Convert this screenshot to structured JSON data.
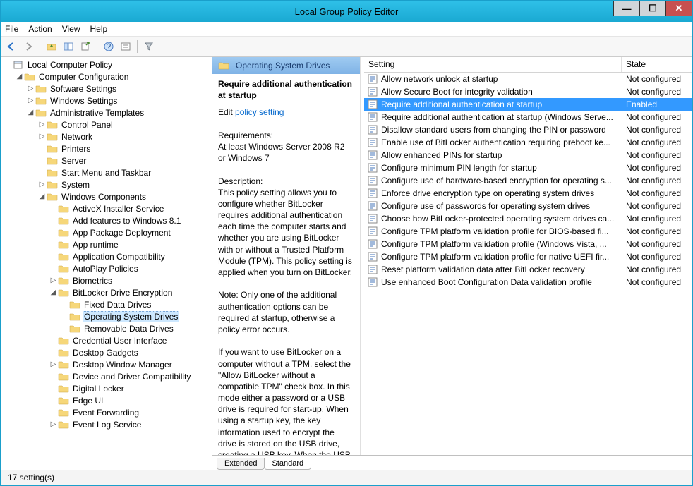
{
  "window": {
    "title": "Local Group Policy Editor"
  },
  "menu": {
    "file": "File",
    "action": "Action",
    "view": "View",
    "help": "Help"
  },
  "tree": {
    "root": "Local Computer Policy",
    "cc": "Computer Configuration",
    "ss": "Software Settings",
    "ws": "Windows Settings",
    "at": "Administrative Templates",
    "cp": "Control Panel",
    "nw": "Network",
    "pr": "Printers",
    "sv": "Server",
    "sm": "Start Menu and Taskbar",
    "sy": "System",
    "wc": "Windows Components",
    "ax": "ActiveX Installer Service",
    "af": "Add features to Windows 8.1",
    "apd": "App Package Deployment",
    "art": "App runtime",
    "ac": "Application Compatibility",
    "ap": "AutoPlay Policies",
    "bm": "Biometrics",
    "bl": "BitLocker Drive Encryption",
    "fdd": "Fixed Data Drives",
    "osd": "Operating System Drives",
    "rdd": "Removable Data Drives",
    "cui": "Credential User Interface",
    "dg": "Desktop Gadgets",
    "dwm": "Desktop Window Manager",
    "ddc": "Device and Driver Compatibility",
    "dl": "Digital Locker",
    "eu": "Edge UI",
    "ef": "Event Forwarding",
    "els": "Event Log Service"
  },
  "detail": {
    "header": "Operating System Drives",
    "policy_name": "Require additional authentication at startup",
    "edit_prefix": "Edit ",
    "edit_link": "policy setting",
    "req_label": "Requirements:",
    "req_text": "At least Windows Server 2008 R2 or Windows 7",
    "desc_label": "Description:",
    "desc_p1": "This policy setting allows you to configure whether BitLocker requires additional authentication each time the computer starts and whether you are using BitLocker with or without a Trusted Platform Module (TPM). This policy setting is applied when you turn on BitLocker.",
    "desc_p2": "Note: Only one of the additional authentication options can be required at startup, otherwise a policy error occurs.",
    "desc_p3": "If you want to use BitLocker on a computer without a TPM, select the \"Allow BitLocker without a compatible TPM\" check box. In this mode either a password or a USB drive is required for start-up. When using a startup key, the key information used to encrypt the drive is stored on the USB drive, creating a USB key. When the USB"
  },
  "list": {
    "col_setting": "Setting",
    "col_state": "State",
    "items": [
      {
        "name": "Allow network unlock at startup",
        "state": "Not configured"
      },
      {
        "name": "Allow Secure Boot for integrity validation",
        "state": "Not configured"
      },
      {
        "name": "Require additional authentication at startup",
        "state": "Enabled",
        "selected": true
      },
      {
        "name": "Require additional authentication at startup (Windows Serve...",
        "state": "Not configured"
      },
      {
        "name": "Disallow standard users from changing the PIN or password",
        "state": "Not configured"
      },
      {
        "name": "Enable use of BitLocker authentication requiring preboot ke...",
        "state": "Not configured"
      },
      {
        "name": "Allow enhanced PINs for startup",
        "state": "Not configured"
      },
      {
        "name": "Configure minimum PIN length for startup",
        "state": "Not configured"
      },
      {
        "name": "Configure use of hardware-based encryption for operating s...",
        "state": "Not configured"
      },
      {
        "name": "Enforce drive encryption type on operating system drives",
        "state": "Not configured"
      },
      {
        "name": "Configure use of passwords for operating system drives",
        "state": "Not configured"
      },
      {
        "name": "Choose how BitLocker-protected operating system drives ca...",
        "state": "Not configured"
      },
      {
        "name": "Configure TPM platform validation profile for BIOS-based fi...",
        "state": "Not configured"
      },
      {
        "name": "Configure TPM platform validation profile (Windows Vista, ...",
        "state": "Not configured"
      },
      {
        "name": "Configure TPM platform validation profile for native UEFI fir...",
        "state": "Not configured"
      },
      {
        "name": "Reset platform validation data after BitLocker recovery",
        "state": "Not configured"
      },
      {
        "name": "Use enhanced Boot Configuration Data validation profile",
        "state": "Not configured"
      }
    ]
  },
  "tabs": {
    "extended": "Extended",
    "standard": "Standard"
  },
  "status": "17 setting(s)"
}
